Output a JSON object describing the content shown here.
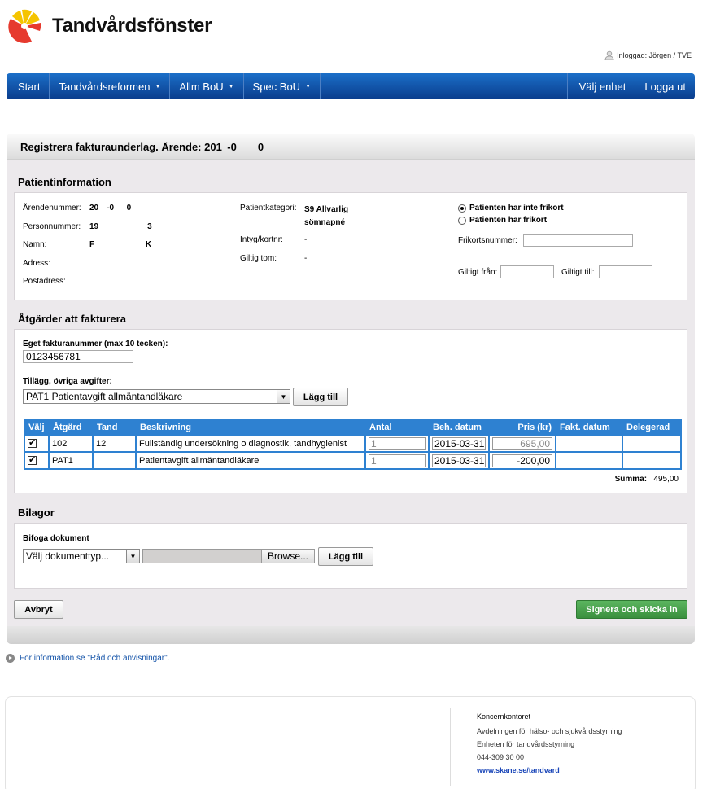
{
  "header": {
    "title": "Tandvårdsfönster",
    "login": "Inloggad: Jörgen / TVE"
  },
  "nav": {
    "left": [
      "Start",
      "Tandvårdsreformen",
      "Allm BoU",
      "Spec BoU"
    ],
    "right": [
      "Välj enhet",
      "Logga ut"
    ]
  },
  "panel": {
    "title": "Registrera fakturaunderlag. Ärende: 201 -0  0"
  },
  "patient": {
    "section": "Patientinformation",
    "fields": [
      {
        "label": "Ärendenummer:",
        "value": "20 -0    0"
      },
      {
        "label": "Personnummer:",
        "value": "19      3"
      },
      {
        "label": "Namn:",
        "value": "F       K"
      },
      {
        "label": "Adress:",
        "value": ""
      },
      {
        "label": "Postadress:",
        "value": ""
      }
    ],
    "category_label": "Patientkategori:",
    "category_value": "S9 Allvarlig sömnapné",
    "intyg_label": "Intyg/kortnr:",
    "intyg_value": "-",
    "giltig_label": "Giltig tom:",
    "giltig_value": "-",
    "radio_no_frikort": "Patienten har inte frikort",
    "radio_frikort": "Patienten har frikort",
    "frikortsnummer_label": "Frikortsnummer:",
    "frikortsnummer_value": "",
    "giltigt_fran_label": "Giltigt från:",
    "giltigt_fran_value": "",
    "giltigt_till_label": "Giltigt till:",
    "giltigt_till_value": ""
  },
  "actions": {
    "section": "Åtgärder att fakturera",
    "invoice_label": "Eget fakturanummer (max 10 tecken):",
    "invoice_value": "0123456781",
    "fees_label": "Tillägg, övriga avgifter:",
    "fees_selected": "PAT1 Patientavgift allmäntandläkare",
    "add_button": "Lägg till",
    "columns": [
      "Välj",
      "Åtgärd",
      "Tand",
      "Beskrivning",
      "Antal",
      "Beh. datum",
      "Pris (kr)",
      "Fakt. datum",
      "Delegerad"
    ],
    "rows": [
      {
        "atgard": "102",
        "tand": "12",
        "beskrivning": "Fullständig undersökning o diagnostik, tandhygienist",
        "antal": "1",
        "datum": "2015-03-31",
        "pris": "695,00",
        "fakt": "",
        "deleg": ""
      },
      {
        "atgard": "PAT1",
        "tand": "",
        "beskrivning": "Patientavgift allmäntandläkare",
        "antal": "1",
        "datum": "2015-03-31",
        "pris": "-200,00",
        "fakt": "",
        "deleg": ""
      }
    ],
    "summa_label": "Summa:",
    "summa_value": "495,00"
  },
  "bilagor": {
    "section": "Bilagor",
    "label": "Bifoga dokument",
    "doc_type": "Välj dokumenttyp...",
    "browse": "Browse...",
    "add_button": "Lägg till"
  },
  "buttons": {
    "cancel": "Avbryt",
    "submit": "Signera och skicka in"
  },
  "info_link": "För information se \"Råd och anvisningar\".",
  "footer": {
    "org": "Koncernkontoret",
    "lines": [
      "Avdelningen för hälso- och sjukvårdsstyrning",
      "Enheten för tandvårdsstyrning",
      "044-309 30 00"
    ],
    "link": "www.skane.se/tandvard"
  }
}
